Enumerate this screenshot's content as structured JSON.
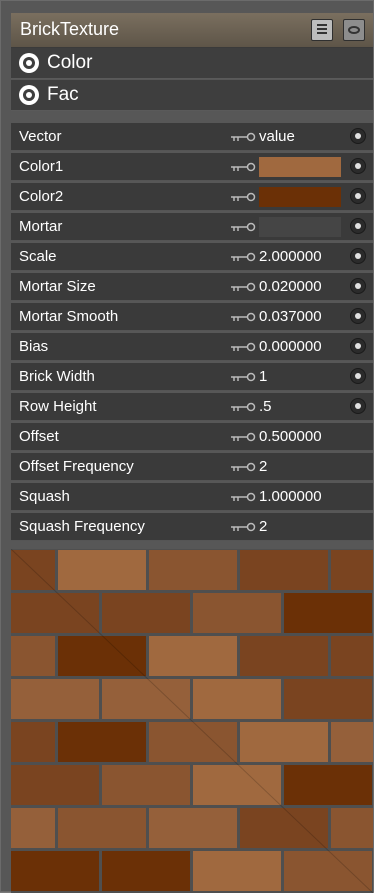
{
  "node": {
    "title": "BrickTexture",
    "outputs": [
      {
        "label": "Color"
      },
      {
        "label": "Fac"
      }
    ],
    "properties": [
      {
        "label": "Vector",
        "value": "value",
        "socket": true
      },
      {
        "label": "Color1",
        "swatch": "#a0693f",
        "socket": true
      },
      {
        "label": "Color2",
        "swatch": "#6b3006",
        "socket": true
      },
      {
        "label": "Mortar",
        "swatch": "#454545",
        "socket": true
      },
      {
        "label": "Scale",
        "value": "2.000000",
        "socket": true
      },
      {
        "label": "Mortar Size",
        "value": "0.020000",
        "socket": true
      },
      {
        "label": "Mortar Smooth",
        "value": "0.037000",
        "socket": true
      },
      {
        "label": "Bias",
        "value": "0.000000",
        "socket": true
      },
      {
        "label": "Brick Width",
        "value": "1",
        "socket": true
      },
      {
        "label": "Row Height",
        "value": ".5",
        "socket": true
      },
      {
        "label": "Offset",
        "value": "0.500000",
        "socket": false
      },
      {
        "label": "Offset Frequency",
        "value": "2",
        "socket": false
      },
      {
        "label": "Squash",
        "value": "1.000000",
        "socket": false
      },
      {
        "label": "Squash Frequency",
        "value": "2",
        "socket": false
      }
    ]
  },
  "preview": {
    "mortar_color": "#4f4f4f",
    "brick_colors": [
      "#a0693f",
      "#8a5530",
      "#7a4420",
      "#6b3006",
      "#95603a"
    ]
  }
}
